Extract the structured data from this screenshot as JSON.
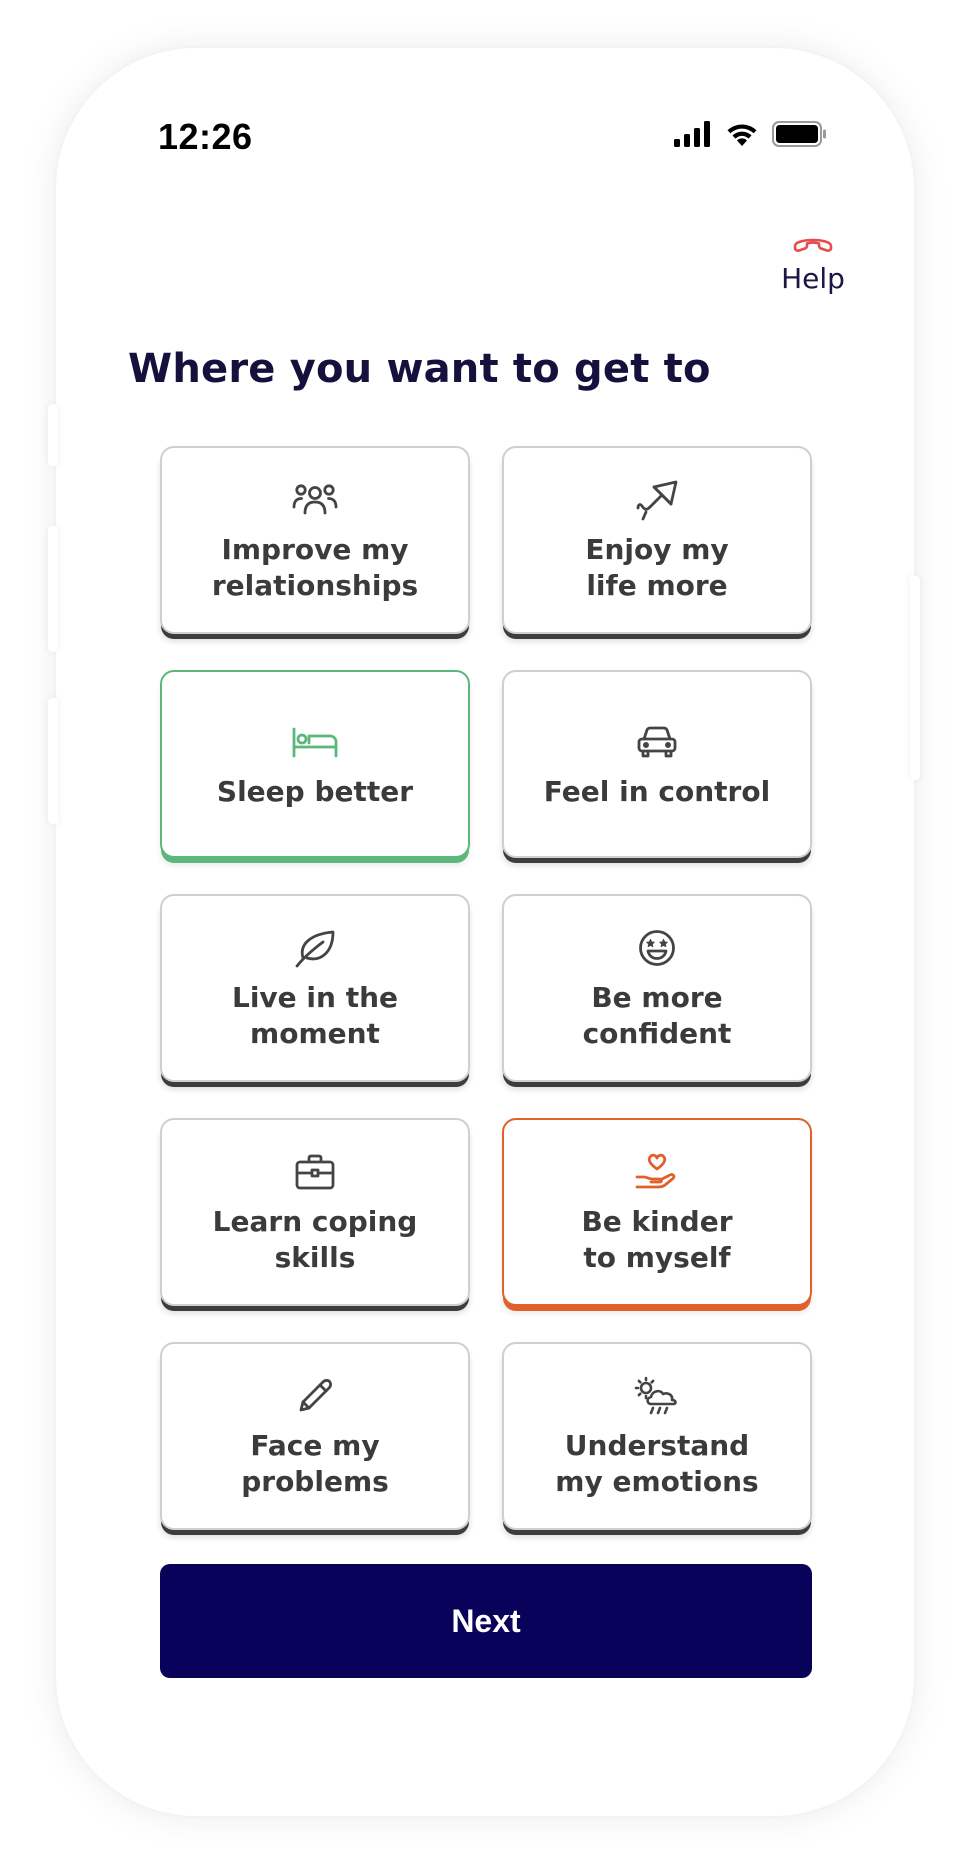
{
  "status_bar": {
    "time": "12:26",
    "icons": [
      "signal-icon",
      "wifi-icon",
      "battery-icon"
    ]
  },
  "header": {
    "help_label": "Help",
    "help_icon": "phone-hangup-icon",
    "help_icon_color": "#e84b4b"
  },
  "page": {
    "title": "Where you want to get to"
  },
  "goals": [
    {
      "label": "Improve my\nrelationships",
      "icon": "people-group-icon",
      "state": "default"
    },
    {
      "label": "Enjoy my\nlife more",
      "icon": "kite-icon",
      "state": "default"
    },
    {
      "label": "Sleep better",
      "icon": "bed-icon",
      "state": "selected-green"
    },
    {
      "label": "Feel in control",
      "icon": "car-icon",
      "state": "default"
    },
    {
      "label": "Live in the\nmoment",
      "icon": "leaf-icon",
      "state": "default"
    },
    {
      "label": "Be more\nconfident",
      "icon": "smiley-star-eyes-icon",
      "state": "default"
    },
    {
      "label": "Learn coping\nskills",
      "icon": "briefcase-icon",
      "state": "default"
    },
    {
      "label": "Be kinder\nto myself",
      "icon": "heart-hand-icon",
      "state": "selected-orange"
    },
    {
      "label": "Face my\nproblems",
      "icon": "pencil-icon",
      "state": "default"
    },
    {
      "label": "Understand\nmy emotions",
      "icon": "weather-sun-rain-cloud-icon",
      "state": "default"
    }
  ],
  "colors": {
    "primary": "#08025a",
    "title": "#14123d",
    "green": "#5cb87a",
    "orange": "#e0612c",
    "text": "#3b3b3b"
  },
  "footer": {
    "next_label": "Next"
  }
}
